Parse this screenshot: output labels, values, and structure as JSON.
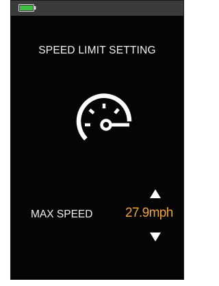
{
  "screen": {
    "title": "SPEED LIMIT SETTING",
    "icon": "speedometer-icon",
    "battery": {
      "icon": "battery-icon",
      "color": "#3fbf3f"
    }
  },
  "setting": {
    "label": "MAX SPEED",
    "value": "27.9mph",
    "value_color": "#f2a23a",
    "increase_icon": "arrow-up-icon",
    "decrease_icon": "arrow-down-icon"
  }
}
